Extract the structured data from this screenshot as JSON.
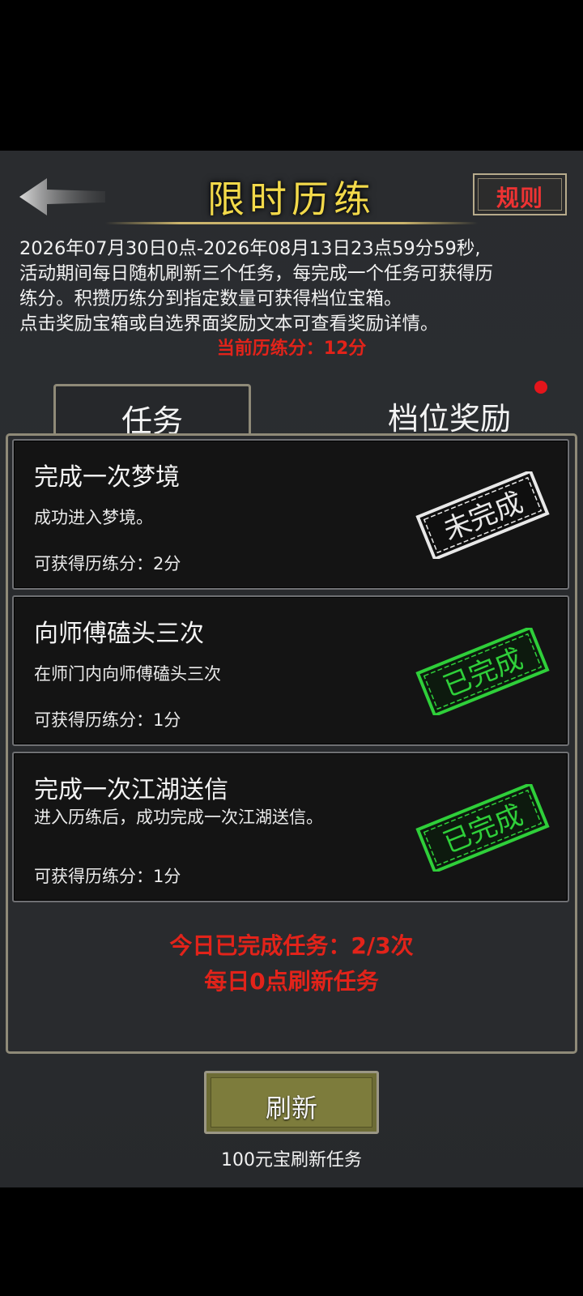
{
  "header": {
    "title": "限时历练",
    "rules_label": "规则"
  },
  "description": {
    "lines": [
      "2026年07月30日0点-2026年08月13日23点59分59秒,",
      "活动期间每日随机刷新三个任务，每完成一个任务可获得历",
      "练分。积攒历练分到指定数量可获得档位宝箱。",
      "点击奖励宝箱或自选界面奖励文本可查看奖励详情。"
    ],
    "current_score": "当前历练分：12分"
  },
  "tabs": {
    "task": "任务",
    "reward": "档位奖励"
  },
  "tasks": [
    {
      "title": "完成一次梦境",
      "desc": "成功进入梦境。",
      "points": "可获得历练分：2分",
      "status": "未完成",
      "status_color": "#e8e8e8"
    },
    {
      "title": "向师傅磕头三次",
      "desc": "在师门内向师傅磕头三次",
      "points": "可获得历练分：1分",
      "status": "已完成",
      "status_color": "#2fcf3a"
    },
    {
      "title": "完成一次江湖送信",
      "desc": "进入历练后，成功完成一次江湖送信。",
      "points": "可获得历练分：1分",
      "status": "已完成",
      "status_color": "#2fcf3a"
    }
  ],
  "summary": {
    "completed": "今日已完成任务：2/3次",
    "refresh_note": "每日0点刷新任务"
  },
  "refresh": {
    "label": "刷新",
    "cost": "100元宝刷新任务"
  },
  "colors": {
    "title": "#f2d94a",
    "accent_red": "#e2231a",
    "done_green": "#2fcf3a",
    "button_olive": "#7d7c3c"
  }
}
